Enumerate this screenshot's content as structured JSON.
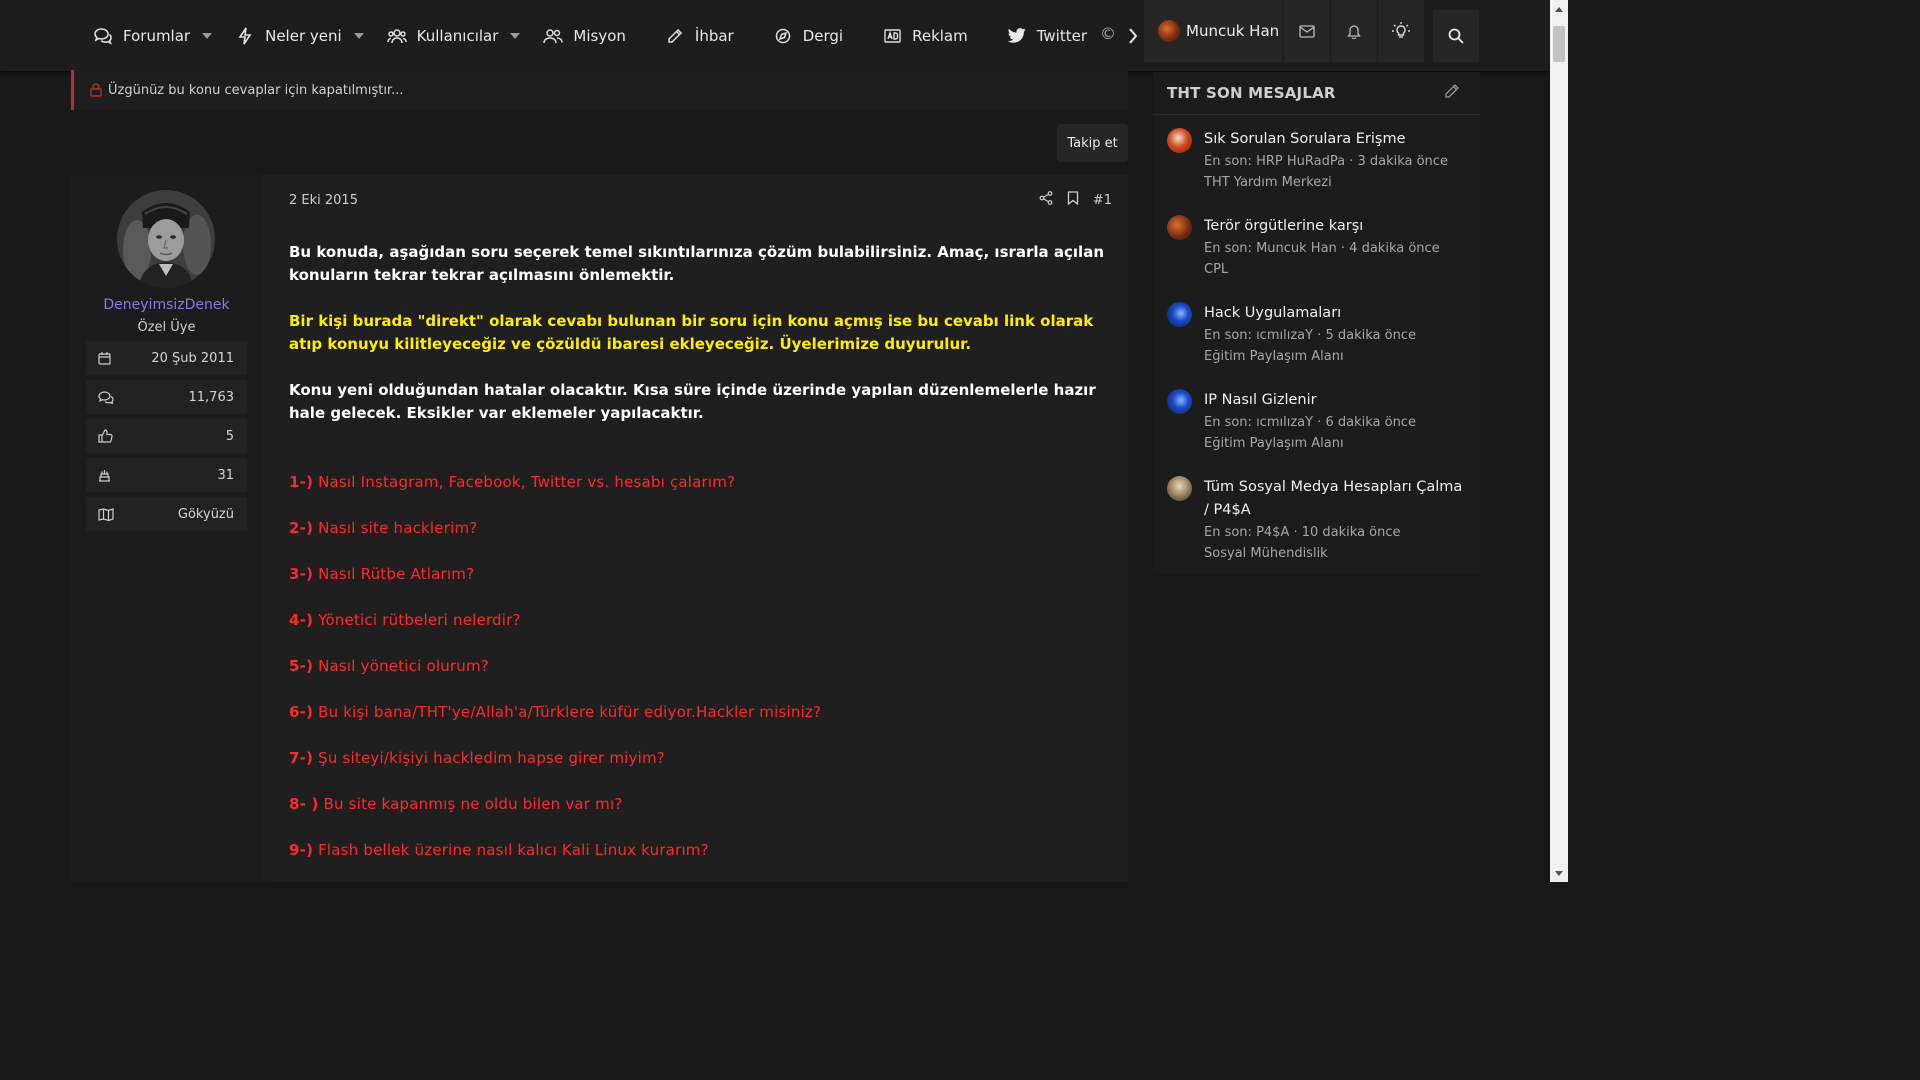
{
  "nav": {
    "items": [
      {
        "label": "Forumlar",
        "icon": "forum-icon",
        "dropdown": true
      },
      {
        "label": "Neler yeni",
        "icon": "lightning-icon",
        "dropdown": true
      },
      {
        "label": "Kullanıcılar",
        "icon": "users-icon",
        "dropdown": true
      },
      {
        "label": "Misyon",
        "icon": "group-icon",
        "dropdown": false
      },
      {
        "label": "İhbar",
        "icon": "pencil-icon",
        "dropdown": false
      },
      {
        "label": "Dergi",
        "icon": "compass-icon",
        "dropdown": false
      },
      {
        "label": "Reklam",
        "icon": "ad-icon",
        "dropdown": false
      },
      {
        "label": "Twitter",
        "icon": "twitter-icon",
        "dropdown": false
      }
    ],
    "user": "Muncuk Han"
  },
  "notice": "Üzgünüz bu konu cevaplar için kapatılmıştır...",
  "follow_label": "Takip et",
  "post": {
    "date": "2 Eki 2015",
    "number": "#1",
    "author": {
      "name": "DeneyimsizDenek",
      "title": "Özel Üye",
      "stats": [
        {
          "icon": "calendar-icon",
          "value": "20 Şub 2011"
        },
        {
          "icon": "messages-icon",
          "value": "11,763"
        },
        {
          "icon": "thumbs-up-icon",
          "value": "5"
        },
        {
          "icon": "trophy-icon",
          "value": "31"
        },
        {
          "icon": "map-icon",
          "value": "Gökyüzü"
        }
      ]
    },
    "para1": "Bu konuda, aşağıdan soru seçerek temel sıkıntılarınıza çözüm bulabilirsiniz. Amaç, ısrarla açılan konuların tekrar tekrar açılmasını önlemektir.",
    "para2": "Bir kişi burada \"direkt\" olarak cevabı bulunan bir soru için konu açmış ise bu cevabı link olarak atıp konuyu kilitleyeceğiz ve çözüldü ibaresi ekleyeceğiz. Üyelerimize duyurulur.",
    "para3": "Konu yeni olduğundan hatalar olacaktır. Kısa süre içinde üzerinde yapılan düzenlemelerle hazır hale gelecek. Eksikler var eklemeler yapılacaktır.",
    "questions": [
      {
        "num": "1-)",
        "text": " Nasıl Instagram, Facebook, Twitter vs. hesabı çalarım?"
      },
      {
        "num": "2-)",
        "text": " Nasıl site hacklerim?"
      },
      {
        "num": "3-)",
        "text": " Nasıl Rütbe Atlarım?"
      },
      {
        "num": "4-)",
        "text": " Yönetici rütbeleri nelerdir?"
      },
      {
        "num": "5-)",
        "text": " Nasıl yönetici olurum?"
      },
      {
        "num": "6-)",
        "text": " Bu kişi bana/THT'ye/Allah'a/Türklere küfür ediyor.Hackler misiniz?"
      },
      {
        "num": "7-)",
        "text": " Şu siteyi/kişiyi hackledim hapse girer miyim?"
      },
      {
        "num": "8- )",
        "text": " Bu site kapanmış ne oldu bilen var mı?"
      },
      {
        "num": "9-)",
        "text": " Flash bellek üzerine nasıl kalıcı Kali Linux kurarım?"
      }
    ]
  },
  "sidebar": {
    "title": "THT SON MESAJLAR",
    "items": [
      {
        "title": "Sık Sorulan Sorulara Erişme",
        "meta": "En son: HRP HuRadPa · 3 dakika önce",
        "forum": "THT Yardım Merkezi"
      },
      {
        "title": "Terör örgütlerine karşı",
        "meta": "En son: Muncuk Han · 4 dakika önce",
        "forum": "CPL"
      },
      {
        "title": "Hack Uygulamaları",
        "meta": "En son: ıcmılızaY · 5 dakika önce",
        "forum": "Eğitim Paylaşım Alanı"
      },
      {
        "title": "IP Nasıl Gizlenir",
        "meta": "En son: ıcmılızaY · 6 dakika önce",
        "forum": "Eğitim Paylaşım Alanı"
      },
      {
        "title": "Tüm Sosyal Medya Hesapları Çalma / P4$A",
        "meta": "En son: P4$A · 10 dakika önce",
        "forum": "Sosyal Mühendislik"
      }
    ]
  },
  "colors": {
    "question_red": "#ff2a2a",
    "notice_yellow": "#ffee00",
    "username_purple": "#8c7ae6",
    "closed_red": "#c02a2a"
  }
}
